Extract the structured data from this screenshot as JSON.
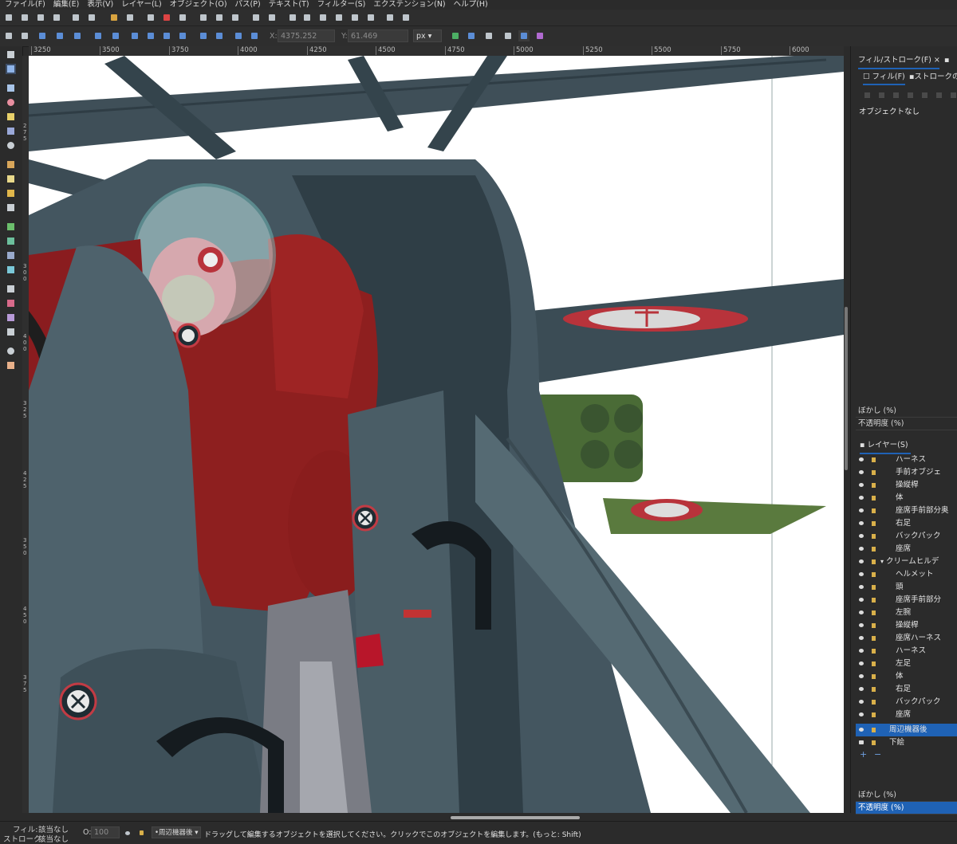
{
  "menu": [
    "ファイル(F)",
    "編集(E)",
    "表示(V)",
    "レイヤー(L)",
    "オブジェクト(O)",
    "パス(P)",
    "テキスト(T)",
    "フィルター(S)",
    "エクステンション(N)",
    "ヘルプ(H)"
  ],
  "controls": {
    "x_label": "X:",
    "x_value": "4375.252",
    "y_label": "Y:",
    "y_value": "61.469",
    "unit": "px"
  },
  "ruler": [
    "3250",
    "3500",
    "3750",
    "4000",
    "4250",
    "4500",
    "4750",
    "5000",
    "5250",
    "5500",
    "5750",
    "6000"
  ],
  "vruler_labels": [
    "2",
    "7",
    "5",
    "3",
    "0",
    "0",
    "3",
    "2",
    "5",
    "3",
    "5",
    "0",
    "3",
    "7",
    "5",
    "4",
    "0",
    "0",
    "4",
    "2",
    "5",
    "4",
    "5",
    "0"
  ],
  "panel": {
    "fill_stroke_tab": "フィル/ストローク(F)",
    "fill_tab": "フィル(F)",
    "stroke_paint_tab": "ストロークの塗",
    "no_object": "オブジェクトなし",
    "blur_label": "ぼかし (%)",
    "opacity_label": "不透明度 (%)",
    "layers_tab": "レイヤー(S)",
    "layers": [
      {
        "name": "ハーネス",
        "type": "layer"
      },
      {
        "name": "手前オブジェ",
        "type": "layer"
      },
      {
        "name": "操縦桿",
        "type": "layer"
      },
      {
        "name": "体",
        "type": "layer"
      },
      {
        "name": "座席手前部分奥",
        "type": "layer"
      },
      {
        "name": "右足",
        "type": "layer"
      },
      {
        "name": "バックパック",
        "type": "layer"
      },
      {
        "name": "座席",
        "type": "layer"
      },
      {
        "name": "クリームヒルデ",
        "type": "group"
      },
      {
        "name": "ヘルメット",
        "type": "layer"
      },
      {
        "name": "頭",
        "type": "layer"
      },
      {
        "name": "座席手前部分",
        "type": "layer"
      },
      {
        "name": "左腕",
        "type": "layer"
      },
      {
        "name": "操縦桿",
        "type": "layer"
      },
      {
        "name": "座席ハーネス",
        "type": "layer"
      },
      {
        "name": "ハーネス",
        "type": "layer"
      },
      {
        "name": "左足",
        "type": "layer"
      },
      {
        "name": "体",
        "type": "layer"
      },
      {
        "name": "右足",
        "type": "layer"
      },
      {
        "name": "バックパック",
        "type": "layer"
      },
      {
        "name": "座席",
        "type": "layer"
      },
      {
        "name": "周辺機器後",
        "type": "selected"
      },
      {
        "name": "下絵",
        "type": "base"
      }
    ],
    "add": "+",
    "remove": "−",
    "blur_label_2": "ぼかし (%)",
    "opacity_label_2": "不透明度 (%)"
  },
  "status": {
    "fill_label": "フィル:",
    "fill_value": "該当なし",
    "stroke_label": "ストローク:",
    "stroke_value": "該当なし",
    "opacity_label": "O:",
    "opacity_value": "100",
    "layer": "•周辺機器後",
    "message": "ドラッグして編集するオブジェクトを選択してください。クリックでこのオブジェクトを編集します。(もっと: Shift)"
  },
  "colors": {
    "accent": "#1f62b5",
    "canvas": "#ffffff",
    "chrome": "#2b2b2b"
  }
}
